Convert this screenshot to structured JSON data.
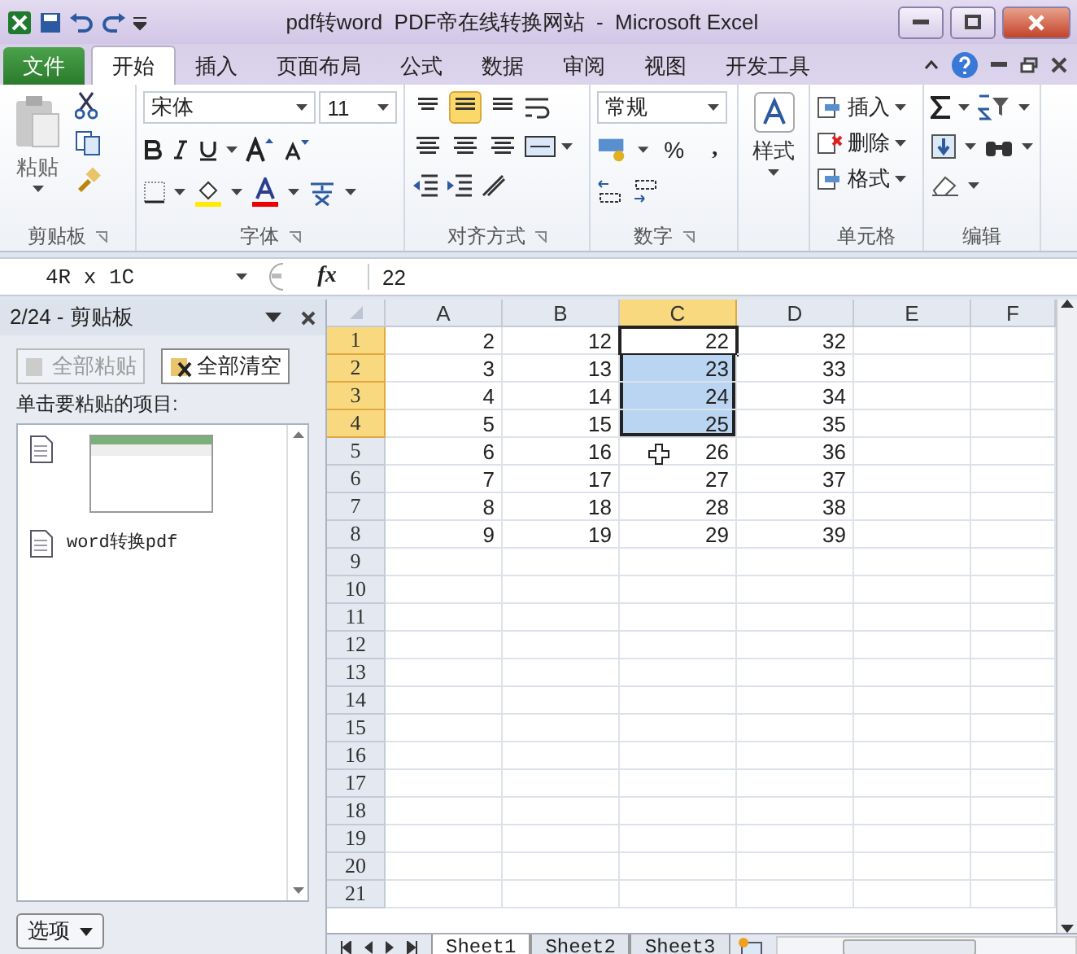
{
  "title_bar": {
    "title": "pdf转word  PDF帝在线转换网站  -  Microsoft Excel"
  },
  "tabs": [
    {
      "label": "文件",
      "kind": "file",
      "selected": false
    },
    {
      "label": "开始",
      "kind": "tab",
      "selected": true
    },
    {
      "label": "插入",
      "kind": "tab",
      "selected": false
    },
    {
      "label": "页面布局",
      "kind": "tab",
      "selected": false
    },
    {
      "label": "公式",
      "kind": "tab",
      "selected": false
    },
    {
      "label": "数据",
      "kind": "tab",
      "selected": false
    },
    {
      "label": "审阅",
      "kind": "tab",
      "selected": false
    },
    {
      "label": "视图",
      "kind": "tab",
      "selected": false
    },
    {
      "label": "开发工具",
      "kind": "tab",
      "selected": false
    }
  ],
  "ribbon": {
    "clipboard": {
      "paste": "粘贴",
      "label": "剪贴板"
    },
    "font": {
      "font_name": "宋体",
      "font_size": "11",
      "label": "字体"
    },
    "alignment": {
      "middle_align_selected": true,
      "label": "对齐方式"
    },
    "number": {
      "format": "常规",
      "percent": "%",
      "comma": ",",
      "label": "数字"
    },
    "styles": {
      "button": "样式"
    },
    "cells": {
      "buttons": [
        "插入",
        "删除",
        "格式"
      ],
      "label": "单元格"
    },
    "editing": {
      "label": "编辑"
    }
  },
  "formula_bar": {
    "name_box": "4R x 1C",
    "fx": "fx",
    "formula": "22"
  },
  "clipboard_pane": {
    "title": "2/24 - 剪贴板",
    "buttons": [
      {
        "label": "全部粘贴",
        "disabled": true
      },
      {
        "label": "全部清空",
        "disabled": false
      }
    ],
    "instruction": "单击要粘贴的项目:",
    "items": [
      {
        "kind": "image"
      },
      {
        "kind": "text",
        "text": "word转换pdf"
      }
    ],
    "options": "选项"
  },
  "grid": {
    "columns": [
      {
        "label": "A",
        "selected": false
      },
      {
        "label": "B",
        "selected": false
      },
      {
        "label": "C",
        "selected": true
      },
      {
        "label": "D",
        "selected": false
      },
      {
        "label": "E",
        "selected": false
      },
      {
        "label": "F",
        "selected": false
      }
    ],
    "rows": [
      {
        "label": "1",
        "selected": true,
        "cells": [
          "2",
          "12",
          "22",
          "32"
        ]
      },
      {
        "label": "2",
        "selected": true,
        "cells": [
          "3",
          "13",
          "23",
          "33"
        ]
      },
      {
        "label": "3",
        "selected": true,
        "cells": [
          "4",
          "14",
          "24",
          "34"
        ]
      },
      {
        "label": "4",
        "selected": true,
        "cells": [
          "5",
          "15",
          "25",
          "35"
        ]
      },
      {
        "label": "5",
        "selected": false,
        "cells": [
          "6",
          "16",
          "26",
          "36"
        ]
      },
      {
        "label": "6",
        "selected": false,
        "cells": [
          "7",
          "17",
          "27",
          "37"
        ]
      },
      {
        "label": "7",
        "selected": false,
        "cells": [
          "8",
          "18",
          "28",
          "38"
        ]
      },
      {
        "label": "8",
        "selected": false,
        "cells": [
          "9",
          "19",
          "29",
          "39"
        ]
      },
      {
        "label": "9",
        "selected": false,
        "cells": []
      },
      {
        "label": "10",
        "selected": false,
        "cells": []
      },
      {
        "label": "11",
        "selected": false,
        "cells": []
      },
      {
        "label": "12",
        "selected": false,
        "cells": []
      },
      {
        "label": "13",
        "selected": false,
        "cells": []
      },
      {
        "label": "14",
        "selected": false,
        "cells": []
      },
      {
        "label": "15",
        "selected": false,
        "cells": []
      },
      {
        "label": "16",
        "selected": false,
        "cells": []
      },
      {
        "label": "17",
        "selected": false,
        "cells": []
      },
      {
        "label": "18",
        "selected": false,
        "cells": []
      },
      {
        "label": "19",
        "selected": false,
        "cells": []
      },
      {
        "label": "20",
        "selected": false,
        "cells": []
      },
      {
        "label": "21",
        "selected": false,
        "cells": []
      }
    ]
  },
  "sheet_tabs": [
    {
      "label": "Sheet1",
      "selected": true
    },
    {
      "label": "Sheet2",
      "selected": false
    },
    {
      "label": "Sheet3",
      "selected": false
    }
  ]
}
